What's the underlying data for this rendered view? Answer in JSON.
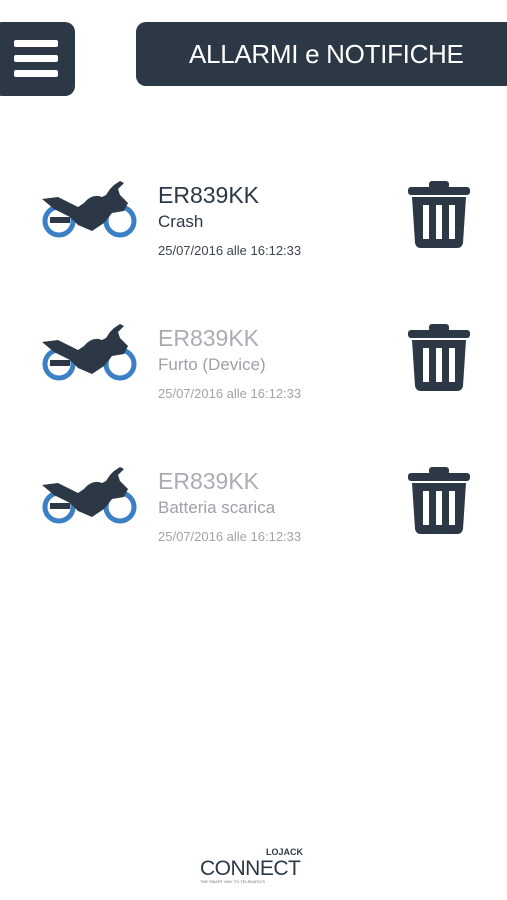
{
  "header": {
    "title": "ALLARMI e NOTIFICHE",
    "menu_icon": "hamburger-menu-icon"
  },
  "colors": {
    "dark": "#2c3846",
    "wheel_blue": "#3b7fc4",
    "faded_text": "#a9adb3",
    "background": "#ffffff"
  },
  "alarms": [
    {
      "plate": "ER839KK",
      "type": "Crash",
      "date": "25/07/2016 alle 16:12:33",
      "vehicle_icon": "motorcycle-icon",
      "delete_icon": "trash-icon"
    },
    {
      "plate": "ER839KK",
      "type": "Furto (Device)",
      "date": "25/07/2016 alle 16:12:33",
      "vehicle_icon": "motorcycle-icon",
      "delete_icon": "trash-icon"
    },
    {
      "plate": "ER839KK",
      "type": "Batteria scarica",
      "date": "25/07/2016 alle 16:12:33",
      "vehicle_icon": "motorcycle-icon",
      "delete_icon": "trash-icon"
    }
  ],
  "footer": {
    "logo_word": "CONNECT",
    "logo_mark": "LOJACK",
    "logo_tagline": "THE SMART WAY TO TELEMATICS"
  }
}
